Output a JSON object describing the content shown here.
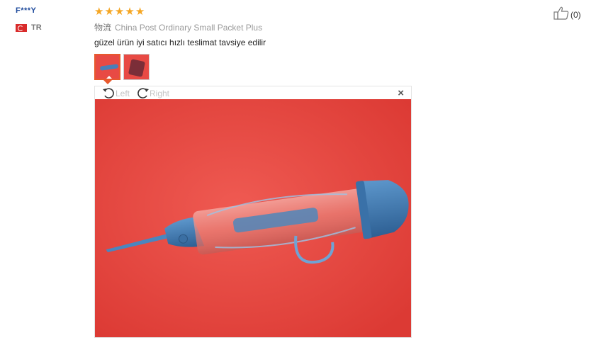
{
  "reviewer": {
    "name": "F***Y",
    "country_code": "TR"
  },
  "rating": {
    "stars": 5,
    "glyph": "★",
    "color": "#f5a623"
  },
  "shipping": {
    "logistics_label": "物流",
    "method": "China Post Ordinary Small Packet Plus"
  },
  "feedback_text": "güzel ürün iyi satıcı hızlı teslimat tavsiye edilir",
  "helpful": {
    "count_label": "(0)"
  },
  "viewer": {
    "rotate_left_label": "Left",
    "rotate_right_label": "Right",
    "close_glyph": "×"
  },
  "photo": {
    "background_color": "#e94640",
    "object_color": "#3e78b0"
  },
  "icons": {
    "thumbs_up": "thumbs-up-icon",
    "rotate_left": "rotate-left-icon",
    "rotate_right": "rotate-right-icon",
    "close": "close-icon",
    "flag": "turkey-flag-icon"
  }
}
